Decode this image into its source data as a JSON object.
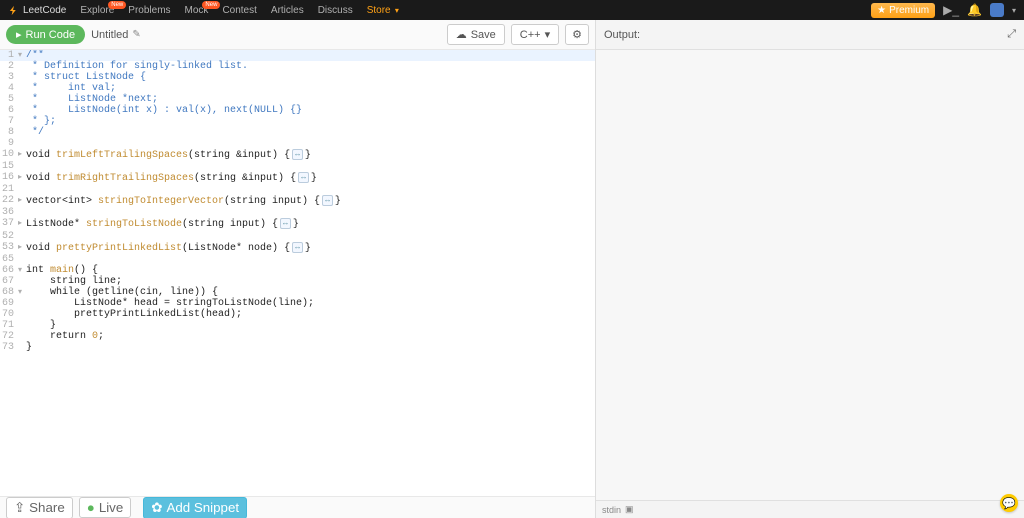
{
  "nav": {
    "brand": "LeetCode",
    "links": [
      {
        "label": "Explore",
        "badge": "New"
      },
      {
        "label": "Problems"
      },
      {
        "label": "Mock",
        "badge": "New"
      },
      {
        "label": "Contest"
      },
      {
        "label": "Articles"
      },
      {
        "label": "Discuss"
      },
      {
        "label": "Store",
        "badge": null,
        "store": true,
        "caret": "▾"
      }
    ],
    "premium": "Premium"
  },
  "toolbar": {
    "run": "Run Code",
    "title": "Untitled",
    "save": "Save",
    "lang": "C++",
    "lang_caret": "▾"
  },
  "bottom": {
    "share": "Share",
    "live": "Live",
    "add_snippet": "Add Snippet"
  },
  "output": {
    "header": "Output:",
    "stdin": "stdin"
  },
  "code_lines": [
    {
      "n": 1,
      "fold": "▾",
      "cls": "cm",
      "text": "/**",
      "hl": true
    },
    {
      "n": 2,
      "cls": "cm",
      "text": " * Definition for singly-linked list."
    },
    {
      "n": 3,
      "cls": "cm",
      "text": " * struct ListNode {"
    },
    {
      "n": 4,
      "cls": "cm",
      "text": " *     int val;"
    },
    {
      "n": 5,
      "cls": "cm",
      "text": " *     ListNode *next;"
    },
    {
      "n": 6,
      "cls": "cm",
      "text": " *     ListNode(int x) : val(x), next(NULL) {}"
    },
    {
      "n": 7,
      "cls": "cm",
      "text": " * };"
    },
    {
      "n": 8,
      "cls": "cm",
      "text": " */"
    },
    {
      "n": 9,
      "text": ""
    },
    {
      "n": 10,
      "fold": "▸",
      "seg": [
        {
          "t": "void ",
          "c": "kw"
        },
        {
          "t": "trimLeftTrailingSpaces",
          "c": "id"
        },
        {
          "t": "(string &input) {",
          "c": "kw"
        },
        {
          "pill": "↔"
        },
        {
          "t": "}",
          "c": "kw"
        }
      ]
    },
    {
      "n": 15,
      "text": ""
    },
    {
      "n": 16,
      "fold": "▸",
      "seg": [
        {
          "t": "void ",
          "c": "kw"
        },
        {
          "t": "trimRightTrailingSpaces",
          "c": "id"
        },
        {
          "t": "(string &input) {",
          "c": "kw"
        },
        {
          "pill": "↔"
        },
        {
          "t": "}",
          "c": "kw"
        }
      ]
    },
    {
      "n": 21,
      "text": ""
    },
    {
      "n": 22,
      "fold": "▸",
      "seg": [
        {
          "t": "vector<int> ",
          "c": "kw"
        },
        {
          "t": "stringToIntegerVector",
          "c": "id"
        },
        {
          "t": "(string input) {",
          "c": "kw"
        },
        {
          "pill": "↔"
        },
        {
          "t": "}",
          "c": "kw"
        }
      ]
    },
    {
      "n": 36,
      "text": ""
    },
    {
      "n": 37,
      "fold": "▸",
      "seg": [
        {
          "t": "ListNode* ",
          "c": "kw"
        },
        {
          "t": "stringToListNode",
          "c": "id"
        },
        {
          "t": "(string input) {",
          "c": "kw"
        },
        {
          "pill": "↔"
        },
        {
          "t": "}",
          "c": "kw"
        }
      ]
    },
    {
      "n": 52,
      "text": ""
    },
    {
      "n": 53,
      "fold": "▸",
      "seg": [
        {
          "t": "void ",
          "c": "kw"
        },
        {
          "t": "prettyPrintLinkedList",
          "c": "id"
        },
        {
          "t": "(ListNode* node) {",
          "c": "kw"
        },
        {
          "pill": "↔"
        },
        {
          "t": "}",
          "c": "kw"
        }
      ]
    },
    {
      "n": 65,
      "text": ""
    },
    {
      "n": 66,
      "fold": "▾",
      "seg": [
        {
          "t": "int ",
          "c": "kw"
        },
        {
          "t": "main",
          "c": "id"
        },
        {
          "t": "() {",
          "c": "kw"
        }
      ]
    },
    {
      "n": 67,
      "seg": [
        {
          "t": "    string line;",
          "c": "kw"
        }
      ]
    },
    {
      "n": 68,
      "fold": "▾",
      "seg": [
        {
          "t": "    while ",
          "c": "kw"
        },
        {
          "t": "(getline(cin, line)) {",
          "c": "kw"
        }
      ]
    },
    {
      "n": 69,
      "seg": [
        {
          "t": "        ListNode* head = stringToListNode(line);",
          "c": "kw"
        }
      ]
    },
    {
      "n": 70,
      "seg": [
        {
          "t": "        prettyPrintLinkedList(head);",
          "c": "kw"
        }
      ]
    },
    {
      "n": 71,
      "seg": [
        {
          "t": "    }",
          "c": "kw"
        }
      ]
    },
    {
      "n": 72,
      "seg": [
        {
          "t": "    return ",
          "c": "kw"
        },
        {
          "t": "0",
          "c": "id"
        },
        {
          "t": ";",
          "c": "kw"
        }
      ]
    },
    {
      "n": 73,
      "seg": [
        {
          "t": "}",
          "c": "kw"
        }
      ]
    }
  ]
}
